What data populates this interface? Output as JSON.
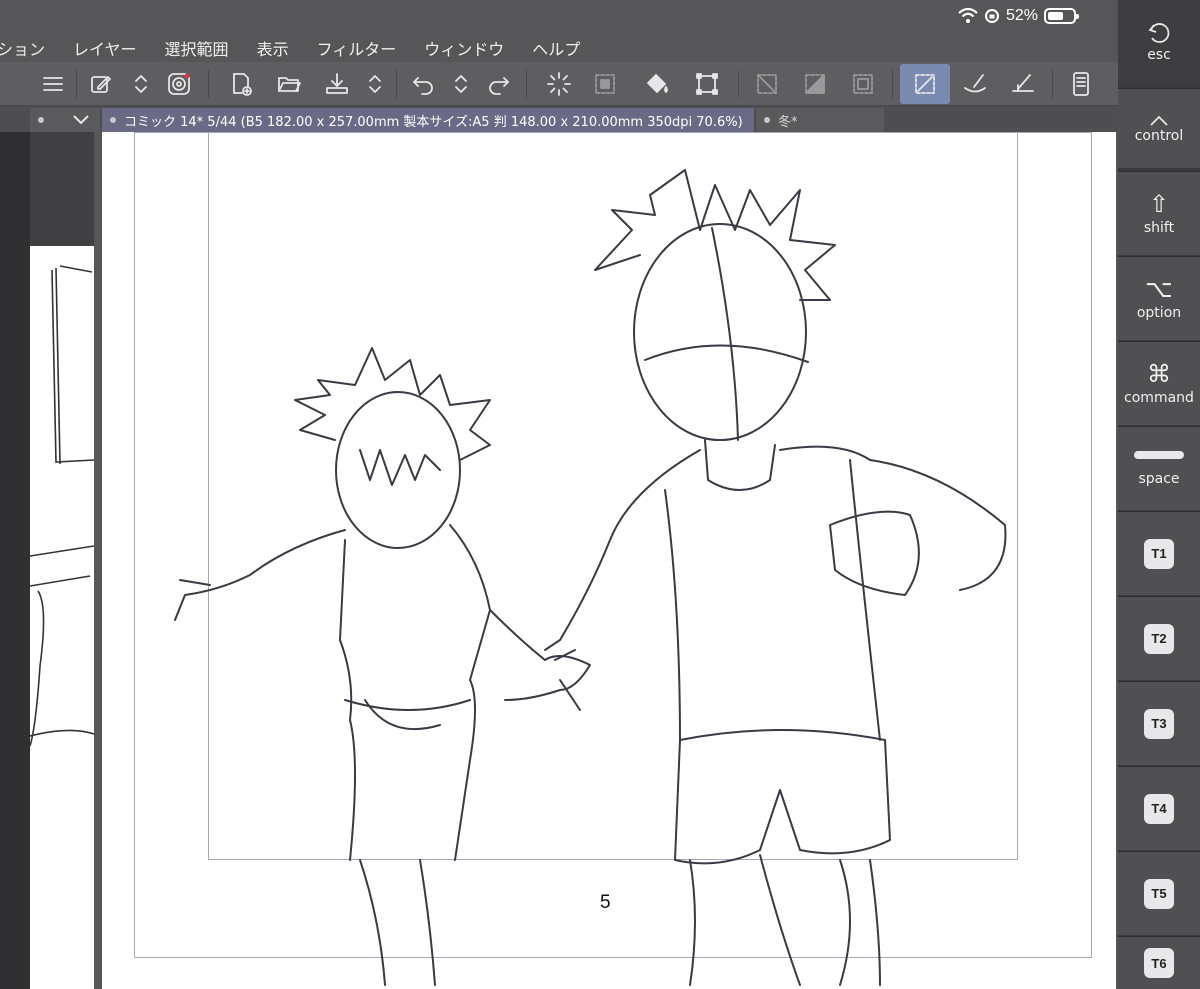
{
  "status": {
    "battery_pct": "52%"
  },
  "menu": [
    "ション",
    "レイヤー",
    "選択範囲",
    "表示",
    "フィルター",
    "ウィンドウ",
    "ヘルプ"
  ],
  "toolbar": {
    "icons": [
      "menu-icon",
      "edit-icon",
      "up-down-icon",
      "spiral-icon",
      "new-page-icon",
      "open-folder-icon",
      "import-icon",
      "up-down-icon",
      "undo-icon",
      "up-down-icon",
      "redo-icon",
      "loading-icon",
      "select-all-icon",
      "fill-icon",
      "transform-icon",
      "deselect-icon",
      "invert-selection-icon",
      "selection-border-icon",
      "pen-active-icon",
      "brush-icon",
      "ruler-pen-icon",
      "tablet-icon"
    ]
  },
  "tabs": {
    "active": "コミック 14* 5/44 (B5 182.00 x 257.00mm 製本サイズ:A5 判 148.00 x 210.00mm 350dpi 70.6%)",
    "second": "冬*"
  },
  "canvas": {
    "page_number": "5"
  },
  "keys": {
    "esc": "esc",
    "control": "control",
    "shift": "shift",
    "option": "option",
    "command": "command",
    "space": "space",
    "shift_symbol": "⇧",
    "option_symbol": "⌥",
    "command_symbol": "⌘",
    "t": [
      "T1",
      "T2",
      "T3",
      "T4",
      "T5",
      "T6"
    ]
  },
  "colors": {
    "accent_active_tab": "#6a6a86",
    "active_tool": "#7a8ab0"
  }
}
